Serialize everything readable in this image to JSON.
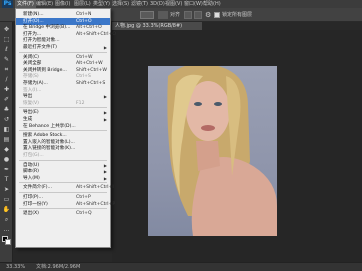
{
  "app": {
    "logo": "Ps"
  },
  "menubar": {
    "items": [
      "文件(F)",
      "编辑(E)",
      "图像(I)",
      "图层(L)",
      "类型(Y)",
      "选择(S)",
      "滤镜(T)",
      "3D(D)",
      "视图(V)",
      "窗口(W)",
      "帮助(H)"
    ]
  },
  "options": {
    "align_label": "对齐",
    "checkbox_label": "锁定所有图层"
  },
  "document": {
    "tab_title": "人物.jpg @ 33.3%(RGB/8#)",
    "zoom": "33.33%",
    "doc_info": "文档:2.96M/2.96M"
  },
  "file_menu": {
    "items": [
      {
        "label": "新建(N)...",
        "shortcut": "Ctrl+N"
      },
      {
        "label": "打开(O)...",
        "shortcut": "Ctrl+O",
        "highlight": true
      },
      {
        "label": "在 Bridge 中浏览(B)...",
        "shortcut": "Alt+Ctrl+O"
      },
      {
        "label": "打开为...",
        "shortcut": "Alt+Shift+Ctrl+O"
      },
      {
        "label": "打开为智能对象..."
      },
      {
        "label": "最近打开文件(T)",
        "submenu": true
      },
      {
        "sep": true
      },
      {
        "label": "关闭(C)",
        "shortcut": "Ctrl+W"
      },
      {
        "label": "关闭全部",
        "shortcut": "Alt+Ctrl+W"
      },
      {
        "label": "关闭并转到 Bridge...",
        "shortcut": "Shift+Ctrl+W"
      },
      {
        "label": "存储(S)",
        "shortcut": "Ctrl+S",
        "disabled": true
      },
      {
        "label": "存储为(A)...",
        "shortcut": "Shift+Ctrl+S"
      },
      {
        "label": "签入(I)...",
        "disabled": true
      },
      {
        "label": "导出",
        "submenu": true
      },
      {
        "label": "恢复(V)",
        "shortcut": "F12",
        "disabled": true
      },
      {
        "sep": true
      },
      {
        "label": "导出(E)",
        "submenu": true
      },
      {
        "label": "生成",
        "submenu": true
      },
      {
        "label": "在 Behance 上共享(D)..."
      },
      {
        "sep": true
      },
      {
        "label": "搜索 Adobe Stock..."
      },
      {
        "label": "置入嵌入的智能对象(L)..."
      },
      {
        "label": "置入链接的智能对象(K)..."
      },
      {
        "label": "打包(G)...",
        "disabled": true
      },
      {
        "sep": true
      },
      {
        "label": "自动(U)",
        "submenu": true
      },
      {
        "label": "脚本(R)",
        "submenu": true
      },
      {
        "label": "导入(M)",
        "submenu": true
      },
      {
        "sep": true
      },
      {
        "label": "文件简介(F)...",
        "shortcut": "Alt+Shift+Ctrl+I"
      },
      {
        "sep": true
      },
      {
        "label": "打印(P)...",
        "shortcut": "Ctrl+P"
      },
      {
        "label": "打印一份(Y)",
        "shortcut": "Alt+Shift+Ctrl+P"
      },
      {
        "sep": true
      },
      {
        "label": "退出(X)",
        "shortcut": "Ctrl+Q"
      }
    ]
  },
  "tools": [
    "move-tool",
    "marquee-tool",
    "lasso-tool",
    "quick-select-tool",
    "crop-tool",
    "eyedropper-tool",
    "healing-tool",
    "brush-tool",
    "clone-stamp-tool",
    "history-brush-tool",
    "eraser-tool",
    "gradient-tool",
    "blur-tool",
    "dodge-tool",
    "pen-tool",
    "type-tool",
    "path-select-tool",
    "shape-tool",
    "hand-tool",
    "zoom-tool",
    "more-tool"
  ],
  "colors": {
    "accent_highlight": "#3b77c9",
    "menu_bg": "#efefef",
    "workspace": "#282828"
  }
}
